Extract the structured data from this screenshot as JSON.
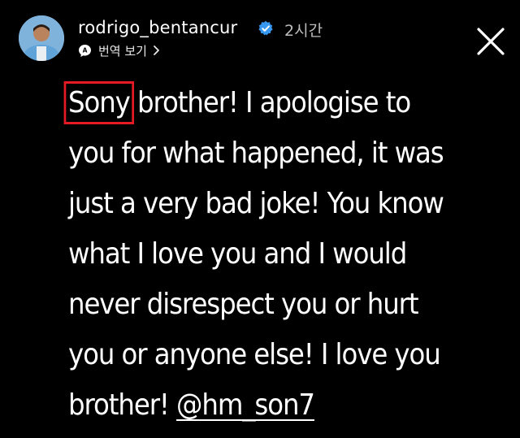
{
  "header": {
    "username": "rodrigo_bentancur",
    "time": "2시간",
    "translate_label": "번역 보기"
  },
  "story": {
    "highlighted_word": "Sony",
    "line1_rest": " brother! I apologise to",
    "line2": "you for what happened, it was",
    "line3": "just a very bad joke! You know",
    "line4": "what I love you and I would",
    "line5": "never disrespect you or hurt",
    "line6": "you or anyone else! I love you",
    "line7_prefix": "brother! ",
    "mention": "@hm_son7"
  },
  "colors": {
    "background": "#000000",
    "highlight_box": "#e51a24",
    "verified_badge": "#3897f0"
  },
  "icons": {
    "verified": "verified-badge-icon",
    "translate": "translate-icon",
    "chevron": "chevron-right-icon",
    "close": "close-icon"
  }
}
